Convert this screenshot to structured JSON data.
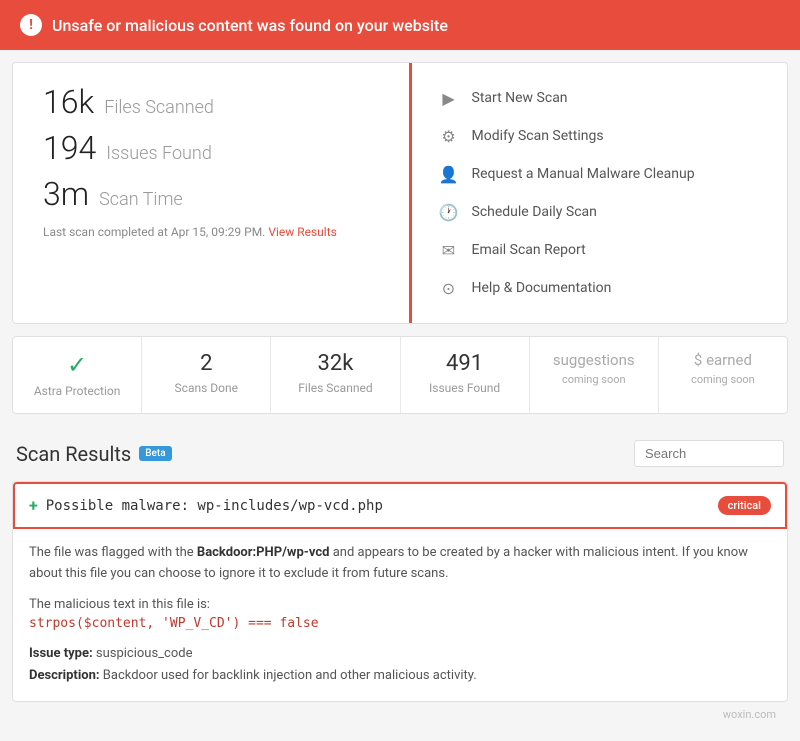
{
  "alert": {
    "icon": "!",
    "message": "Unsafe or malicious content was found on your website"
  },
  "stats": {
    "files_scanned_number": "16k",
    "files_scanned_label": "Files Scanned",
    "issues_found_number": "194",
    "issues_found_label": "Issues Found",
    "scan_time_number": "3m",
    "scan_time_label": "Scan Time",
    "last_scan": "Last scan completed at Apr 15, 09:29 PM.",
    "view_results": "View Results"
  },
  "actions": [
    {
      "id": "start-scan",
      "icon": "▶",
      "label": "Start New Scan"
    },
    {
      "id": "modify-settings",
      "icon": "⚙",
      "label": "Modify Scan Settings"
    },
    {
      "id": "manual-cleanup",
      "icon": "👤",
      "label": "Request a Manual Malware Cleanup"
    },
    {
      "id": "schedule-scan",
      "icon": "🕐",
      "label": "Schedule Daily Scan"
    },
    {
      "id": "email-report",
      "icon": "✉",
      "label": "Email Scan Report"
    },
    {
      "id": "help-docs",
      "icon": "⊙",
      "label": "Help & Documentation"
    }
  ],
  "metrics": [
    {
      "id": "astra-protection",
      "value": "✓",
      "label": "Astra Protection",
      "is_check": true
    },
    {
      "id": "scans-done",
      "value": "2",
      "label": "Scans Done",
      "is_check": false
    },
    {
      "id": "files-scanned",
      "value": "32k",
      "label": "Files Scanned",
      "is_check": false
    },
    {
      "id": "issues-found",
      "value": "491",
      "label": "Issues Found",
      "is_check": false
    },
    {
      "id": "suggestions",
      "value": "suggestions",
      "label": "coming soon",
      "is_soon": true
    },
    {
      "id": "earned",
      "value": "$ earned",
      "label": "coming soon",
      "is_soon": true
    }
  ],
  "scan_results": {
    "title": "Scan Results",
    "beta": "Beta",
    "search_placeholder": "Search"
  },
  "issues": [
    {
      "id": "issue-1",
      "filename": "Possible malware: wp-includes/wp-vcd.php",
      "severity": "critical",
      "description_pre": "The file was flagged with the ",
      "description_bold": "Backdoor:PHP/wp-vcd",
      "description_post": " and appears to be created by a hacker with malicious intent. If you know about this file you can choose to ignore it to exclude it from future scans.",
      "malicious_text_label": "The malicious text in this file is:",
      "code_snippet": "strpos($content, 'WP_V_CD') === false",
      "issue_type_label": "Issue type:",
      "issue_type_value": "suspicious_code",
      "description_label": "Description:",
      "description_value": "Backdoor used for backlink injection and other malicious activity."
    }
  ],
  "watermark": "woxin.com"
}
